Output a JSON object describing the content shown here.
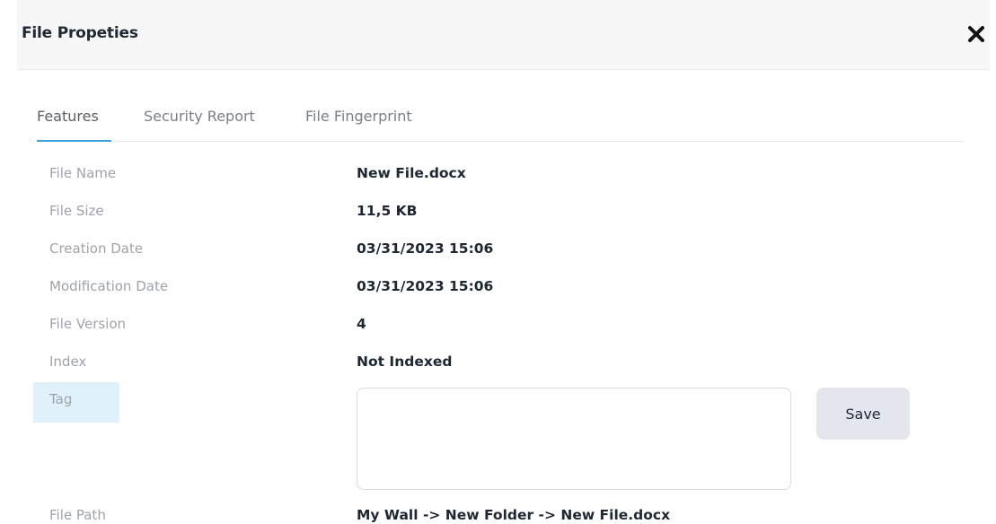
{
  "dialog": {
    "title": "File Propeties",
    "close_icon": "close-icon"
  },
  "tabs": [
    {
      "label": "Features",
      "active": true
    },
    {
      "label": "Security Report",
      "active": false
    },
    {
      "label": "File Fingerprint",
      "active": false
    }
  ],
  "properties": {
    "file_name": {
      "label": "File Name",
      "value": "New File.docx"
    },
    "file_size": {
      "label": "File Size",
      "value": "11,5 KB"
    },
    "creation_date": {
      "label": "Creation Date",
      "value": "03/31/2023 15:06"
    },
    "modification_date": {
      "label": "Modification Date",
      "value": "03/31/2023 15:06"
    },
    "file_version": {
      "label": "File Version",
      "value": "4"
    },
    "index": {
      "label": "Index",
      "value": "Not Indexed"
    },
    "tag": {
      "label": "Tag",
      "value": "",
      "placeholder": ""
    },
    "file_path": {
      "label": "File Path",
      "value": "My Wall -> New Folder -> New File.docx"
    }
  },
  "actions": {
    "save_label": "Save"
  },
  "colors": {
    "accent": "#3aa0e0",
    "tag_highlight": "#e1f1fb",
    "save_button_bg": "#e4e6ee"
  }
}
